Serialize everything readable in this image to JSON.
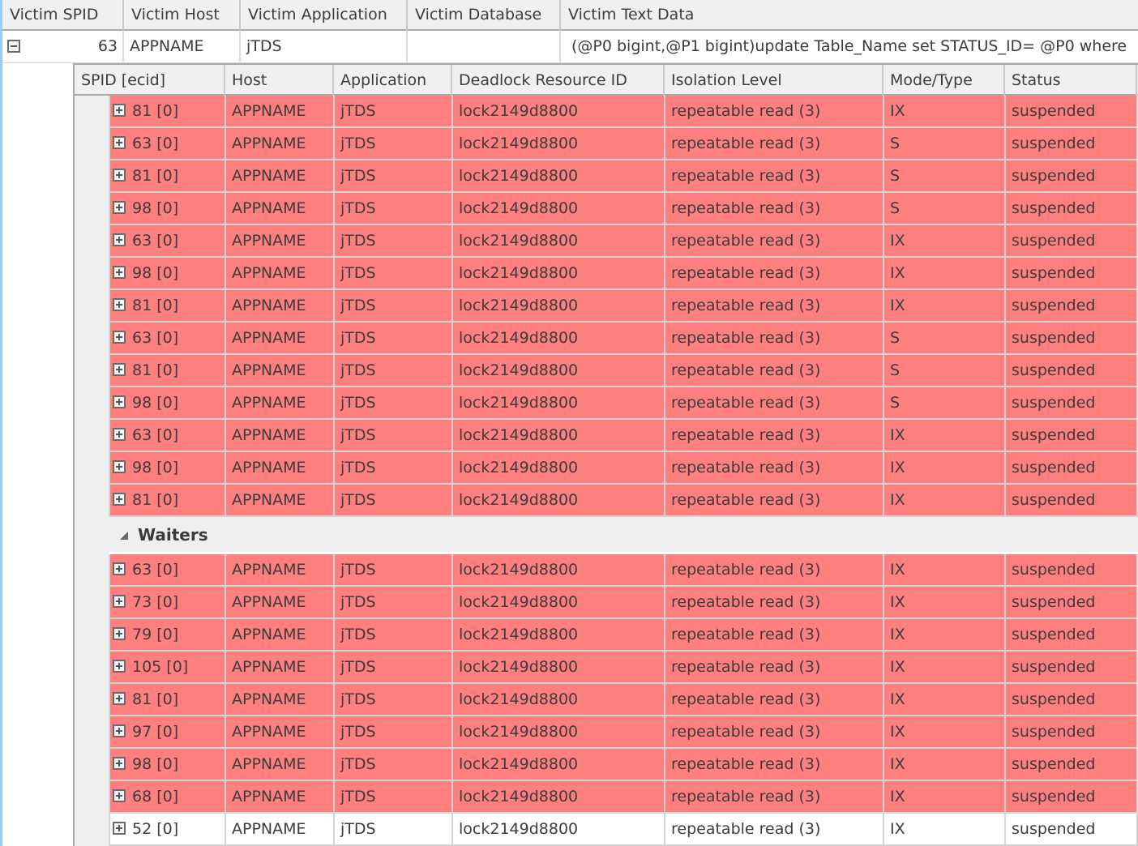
{
  "outer": {
    "headers": [
      "Victim SPID",
      "Victim Host",
      "Victim Application",
      "Victim Database",
      "Victim Text Data"
    ],
    "row": {
      "expanded": true,
      "spid": "63",
      "host": "APPNAME",
      "application": "jTDS",
      "database": "",
      "text_data": "(@P0 bigint,@P1 bigint)update Table_Name set STATUS_ID= @P0 where"
    }
  },
  "detail": {
    "headers": [
      "SPID [ecid]",
      "Host",
      "Application",
      "Deadlock Resource ID",
      "Isolation Level",
      "Mode/Type",
      "Status"
    ],
    "owners": [
      {
        "spid": "81 [0]",
        "host": "APPNAME",
        "app": "jTDS",
        "resource": "lock2149d8800",
        "isolation": "repeatable read (3)",
        "mode": "IX",
        "status": "suspended"
      },
      {
        "spid": "63 [0]",
        "host": "APPNAME",
        "app": "jTDS",
        "resource": "lock2149d8800",
        "isolation": "repeatable read (3)",
        "mode": "S",
        "status": "suspended"
      },
      {
        "spid": "81 [0]",
        "host": "APPNAME",
        "app": "jTDS",
        "resource": "lock2149d8800",
        "isolation": "repeatable read (3)",
        "mode": "S",
        "status": "suspended"
      },
      {
        "spid": "98 [0]",
        "host": "APPNAME",
        "app": "jTDS",
        "resource": "lock2149d8800",
        "isolation": "repeatable read (3)",
        "mode": "S",
        "status": "suspended"
      },
      {
        "spid": "63 [0]",
        "host": "APPNAME",
        "app": "jTDS",
        "resource": "lock2149d8800",
        "isolation": "repeatable read (3)",
        "mode": "IX",
        "status": "suspended"
      },
      {
        "spid": "98 [0]",
        "host": "APPNAME",
        "app": "jTDS",
        "resource": "lock2149d8800",
        "isolation": "repeatable read (3)",
        "mode": "IX",
        "status": "suspended"
      },
      {
        "spid": "81 [0]",
        "host": "APPNAME",
        "app": "jTDS",
        "resource": "lock2149d8800",
        "isolation": "repeatable read (3)",
        "mode": "IX",
        "status": "suspended"
      },
      {
        "spid": "63 [0]",
        "host": "APPNAME",
        "app": "jTDS",
        "resource": "lock2149d8800",
        "isolation": "repeatable read (3)",
        "mode": "S",
        "status": "suspended"
      },
      {
        "spid": "81 [0]",
        "host": "APPNAME",
        "app": "jTDS",
        "resource": "lock2149d8800",
        "isolation": "repeatable read (3)",
        "mode": "S",
        "status": "suspended"
      },
      {
        "spid": "98 [0]",
        "host": "APPNAME",
        "app": "jTDS",
        "resource": "lock2149d8800",
        "isolation": "repeatable read (3)",
        "mode": "S",
        "status": "suspended"
      },
      {
        "spid": "63 [0]",
        "host": "APPNAME",
        "app": "jTDS",
        "resource": "lock2149d8800",
        "isolation": "repeatable read (3)",
        "mode": "IX",
        "status": "suspended"
      },
      {
        "spid": "98 [0]",
        "host": "APPNAME",
        "app": "jTDS",
        "resource": "lock2149d8800",
        "isolation": "repeatable read (3)",
        "mode": "IX",
        "status": "suspended"
      },
      {
        "spid": "81 [0]",
        "host": "APPNAME",
        "app": "jTDS",
        "resource": "lock2149d8800",
        "isolation": "repeatable read (3)",
        "mode": "IX",
        "status": "suspended"
      }
    ],
    "waiters_group": {
      "label": "Waiters",
      "expanded": true
    },
    "waiters": [
      {
        "spid": "63 [0]",
        "host": "APPNAME",
        "app": "jTDS",
        "resource": "lock2149d8800",
        "isolation": "repeatable read (3)",
        "mode": "IX",
        "status": "suspended",
        "highlighted": true
      },
      {
        "spid": "73 [0]",
        "host": "APPNAME",
        "app": "jTDS",
        "resource": "lock2149d8800",
        "isolation": "repeatable read (3)",
        "mode": "IX",
        "status": "suspended",
        "highlighted": true
      },
      {
        "spid": "79 [0]",
        "host": "APPNAME",
        "app": "jTDS",
        "resource": "lock2149d8800",
        "isolation": "repeatable read (3)",
        "mode": "IX",
        "status": "suspended",
        "highlighted": true
      },
      {
        "spid": "105 [0]",
        "host": "APPNAME",
        "app": "jTDS",
        "resource": "lock2149d8800",
        "isolation": "repeatable read (3)",
        "mode": "IX",
        "status": "suspended",
        "highlighted": true
      },
      {
        "spid": "81 [0]",
        "host": "APPNAME",
        "app": "jTDS",
        "resource": "lock2149d8800",
        "isolation": "repeatable read (3)",
        "mode": "IX",
        "status": "suspended",
        "highlighted": true
      },
      {
        "spid": "97 [0]",
        "host": "APPNAME",
        "app": "jTDS",
        "resource": "lock2149d8800",
        "isolation": "repeatable read (3)",
        "mode": "IX",
        "status": "suspended",
        "highlighted": true
      },
      {
        "spid": "98 [0]",
        "host": "APPNAME",
        "app": "jTDS",
        "resource": "lock2149d8800",
        "isolation": "repeatable read (3)",
        "mode": "IX",
        "status": "suspended",
        "highlighted": true
      },
      {
        "spid": "68 [0]",
        "host": "APPNAME",
        "app": "jTDS",
        "resource": "lock2149d8800",
        "isolation": "repeatable read (3)",
        "mode": "IX",
        "status": "suspended",
        "highlighted": true
      },
      {
        "spid": "52 [0]",
        "host": "APPNAME",
        "app": "jTDS",
        "resource": "lock2149d8800",
        "isolation": "repeatable read (3)",
        "mode": "IX",
        "status": "suspended",
        "highlighted": false
      }
    ]
  },
  "colors": {
    "highlight_row": "#ff7f7f",
    "header_bg": "#f0f0f0",
    "grid_line": "#d4d4d4",
    "left_accent": "#9ccaf0"
  },
  "icons": {
    "collapse": "minus-box-icon",
    "expand": "plus-box-icon",
    "group_expanded": "triangle-expanded-icon"
  }
}
